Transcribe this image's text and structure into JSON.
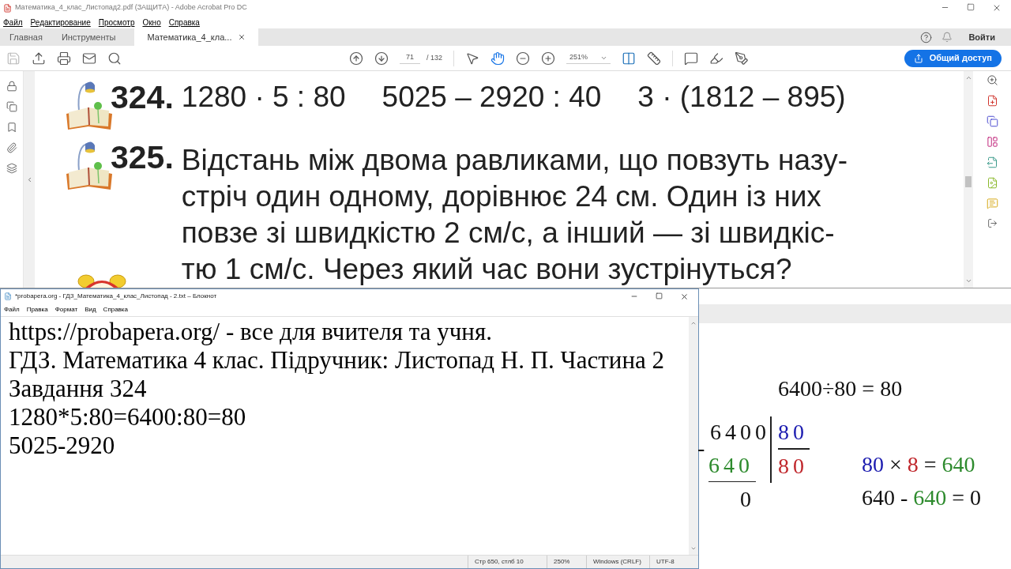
{
  "acrobat": {
    "title": "Математика_4_клас_Листопад2.pdf (ЗАЩИТА) - Adobe Acrobat Pro DC",
    "menu": [
      "Файл",
      "Редактирование",
      "Просмотр",
      "Окно",
      "Справка"
    ],
    "tabs": [
      {
        "label": "Главная",
        "selected": false,
        "kind": "home"
      },
      {
        "label": "Инструменты",
        "selected": false,
        "kind": "home"
      },
      {
        "label": "Математика_4_кла...",
        "selected": true,
        "kind": "document"
      }
    ],
    "sign_in": "Войти",
    "page_current": "71",
    "page_total": "/ 132",
    "zoom": "251%",
    "share_button": "Общий доступ"
  },
  "document": {
    "problems": [
      {
        "number": "324.",
        "kind": "expressions",
        "lines": [
          "1280 · 5 : 80",
          "5025 – 2920 : 40",
          "3 · (1812 – 895)"
        ]
      },
      {
        "number": "325.",
        "kind": "text",
        "lines": [
          "Відстань між двома равликами, що повзуть назу-",
          "стріч один одному, дорівнює 24 см. Один із них",
          "повзе зі швидкістю 2 см/с, а інший — зі швидкіс-",
          "тю 1 см/с. Через який час вони зустрінуться?"
        ]
      }
    ]
  },
  "notepad": {
    "title": "*probapera.org - ГДЗ_Математика_4_клас_Листопад - 2.txt – Блокнот",
    "menu": [
      "Файл",
      "Правка",
      "Формат",
      "Вид",
      "Справка"
    ],
    "lines": [
      "https://probapera.org/ - все для вчителя та учня.",
      "ГДЗ. Математика 4 клас. Підручник: Листопад Н. П. Частина 2",
      "Завдання 324",
      "1280*5:80=6400:80=80",
      "5025-2920"
    ],
    "status": [
      "Стр 650, стлб 10",
      "250%",
      "Windows (CRLF)",
      "UTF-8"
    ]
  },
  "whiteboard": {
    "equation": "6400÷80 = 80",
    "division": {
      "dividend": {
        "text": "6400",
        "color": "#111111"
      },
      "divisor": {
        "text": "80",
        "color": "#1c1cb0"
      },
      "sign": "-",
      "subtrahend": {
        "text": "640",
        "color": "#2e8b2e"
      },
      "quotient": {
        "text": "80",
        "color": "#c0282d"
      },
      "remainder": {
        "text": "0",
        "color": "#111111"
      }
    },
    "checks": [
      [
        {
          "text": "80",
          "color": "#1c1cb0"
        },
        {
          "text": " × ",
          "color": "#111111"
        },
        {
          "text": "8",
          "color": "#c0282d"
        },
        {
          "text": " = ",
          "color": "#111111"
        },
        {
          "text": "640",
          "color": "#2e8b2e"
        }
      ],
      [
        {
          "text": "640 - ",
          "color": "#111111"
        },
        {
          "text": "640",
          "color": "#2e8b2e"
        },
        {
          "text": " = 0",
          "color": "#111111"
        }
      ]
    ]
  }
}
